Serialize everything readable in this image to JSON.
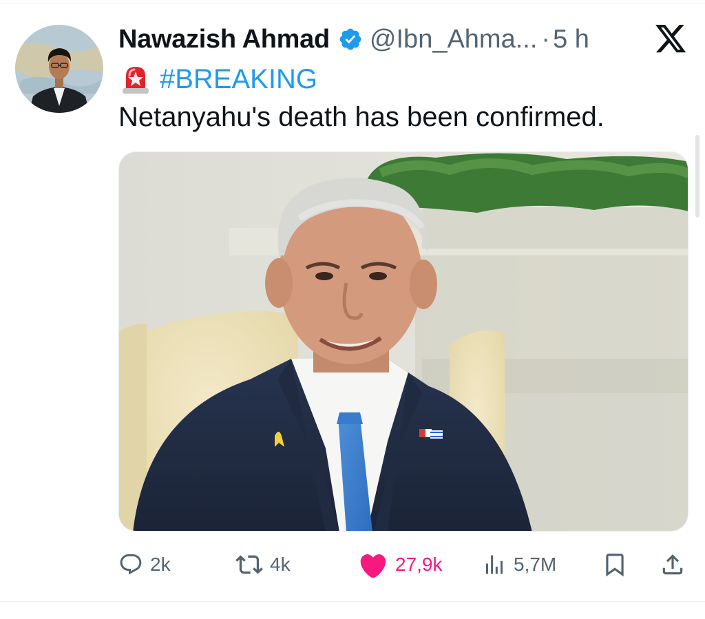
{
  "tweet": {
    "author": {
      "display_name": "Nawazish Ahmad",
      "handle": "@Ibn_Ahma...",
      "verified": true,
      "avatar": "profile-photo"
    },
    "separator": "·",
    "time": "5 h",
    "platform_icon": "x-logo-icon",
    "emoji": "siren-emoji",
    "hashtag": "#BREAKING",
    "text": "Netanyahu's death has been confirmed.",
    "media": "photo-of-man-in-suit"
  },
  "actions": {
    "replies": {
      "icon": "reply-icon",
      "count": "2k"
    },
    "retweets": {
      "icon": "retweet-icon",
      "count": "4k"
    },
    "likes": {
      "icon": "heart-icon",
      "count": "27,9k"
    },
    "views": {
      "icon": "views-icon",
      "count": "5,7M"
    },
    "bookmark": {
      "icon": "bookmark-icon"
    },
    "share": {
      "icon": "share-icon"
    }
  },
  "colors": {
    "link_blue": "#1d9bf0",
    "secondary_text": "#536471",
    "like_pink": "#f91880",
    "verified_blue": "#1d9bf0"
  }
}
